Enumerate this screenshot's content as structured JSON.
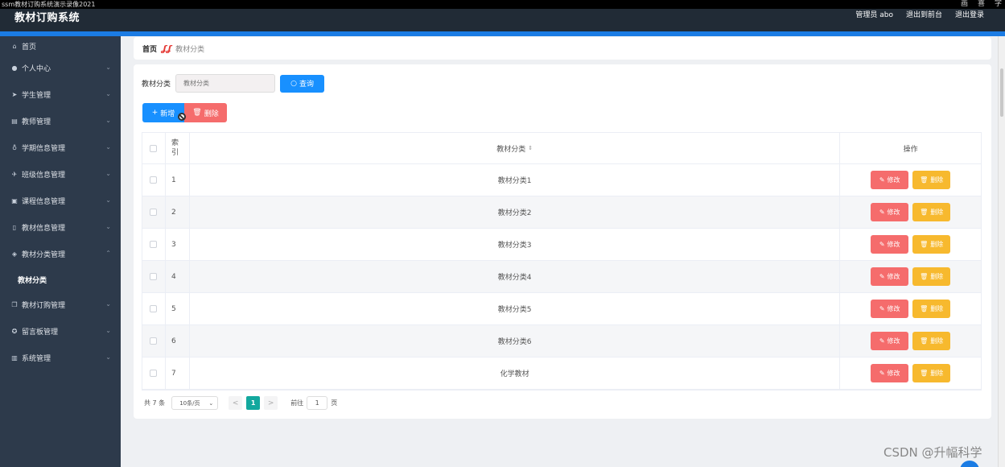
{
  "recorder": {
    "title": "ssm教材订购系统演示录像2021",
    "controls": [
      "画",
      "喜",
      "字"
    ]
  },
  "header": {
    "brand": "教材订购系统",
    "admin": "管理员 abo",
    "back": "退出到前台",
    "logout": "退出登录"
  },
  "sidebar": {
    "items": [
      {
        "label": "首页",
        "icon": "home-icon"
      },
      {
        "label": "个人中心",
        "icon": "user-icon"
      },
      {
        "label": "学生管理",
        "icon": "send-icon"
      },
      {
        "label": "教师管理",
        "icon": "list-icon"
      },
      {
        "label": "学期信息管理",
        "icon": "mic-icon"
      },
      {
        "label": "班级信息管理",
        "icon": "plane-icon"
      },
      {
        "label": "课程信息管理",
        "icon": "book-icon"
      },
      {
        "label": "教材信息管理",
        "icon": "doc-icon"
      },
      {
        "label": "教材分类管理",
        "icon": "tag-icon"
      },
      {
        "label": "教材订购管理",
        "icon": "copy-icon"
      },
      {
        "label": "留言板管理",
        "icon": "chat-icon"
      },
      {
        "label": "系统管理",
        "icon": "chart-icon"
      }
    ],
    "sub": "教材分类"
  },
  "breadcrumb": {
    "home": "首页",
    "sep": "ʆʆ",
    "current": "教材分类"
  },
  "search": {
    "label": "教材分类",
    "placeholder": "教材分类",
    "button": "查询"
  },
  "toolbar": {
    "add": "新增",
    "delete": "删除"
  },
  "table": {
    "headers": {
      "index": "索引",
      "name": "教材分类",
      "sort": "⇕",
      "op": "操作"
    },
    "rows": [
      {
        "index": "1",
        "name": "教材分类1"
      },
      {
        "index": "2",
        "name": "教材分类2"
      },
      {
        "index": "3",
        "name": "教材分类3"
      },
      {
        "index": "4",
        "name": "教材分类4"
      },
      {
        "index": "5",
        "name": "教材分类5"
      },
      {
        "index": "6",
        "name": "教材分类6"
      },
      {
        "index": "7",
        "name": "化学教材"
      }
    ],
    "edit_label": "修改",
    "delete_label": "删除"
  },
  "pager": {
    "total": "共 7 条",
    "size": "10条/页",
    "prev": "<",
    "page": "1",
    "next": ">",
    "goto": "前往",
    "jump": "1",
    "unit": "页"
  },
  "watermark": "CSDN @升幅科学",
  "colors": {
    "sidebar": "#2d3a4b",
    "topbar": "#212b36",
    "accent": "#1b7ce4",
    "danger": "#f56c6c",
    "warning": "#f7b92e",
    "page_active": "#13a89e"
  }
}
